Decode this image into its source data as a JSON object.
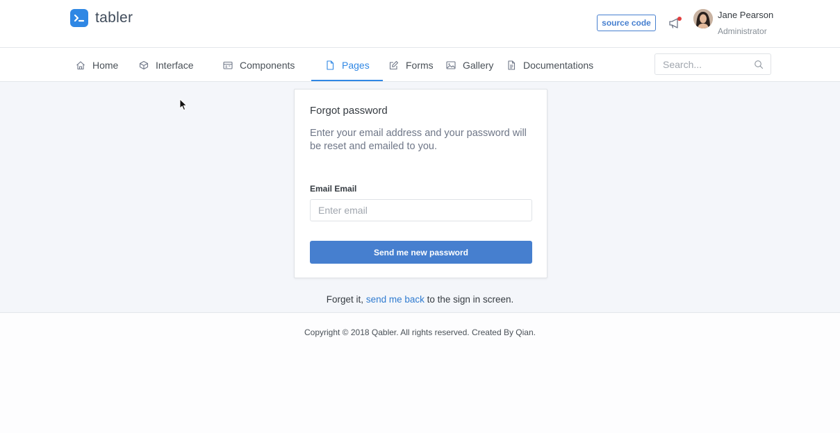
{
  "brand": {
    "name": "tabler",
    "accent_color": "#2f87e4"
  },
  "header": {
    "source_button_label": "source code",
    "user": {
      "name": "Jane Pearson",
      "role": "Administrator"
    },
    "notification_icon": "megaphone-icon"
  },
  "nav": {
    "items": [
      {
        "label": "Home",
        "icon": "home-icon"
      },
      {
        "label": "Interface",
        "icon": "box-icon"
      },
      {
        "label": "Components",
        "icon": "calendar-icon"
      },
      {
        "label": "Pages",
        "icon": "file-icon",
        "active": true
      },
      {
        "label": "Forms",
        "icon": "edit-icon"
      },
      {
        "label": "Gallery",
        "icon": "image-icon"
      },
      {
        "label": "Documentations",
        "icon": "file-text-icon"
      }
    ],
    "search_placeholder": "Search..."
  },
  "card": {
    "title": "Forgot password",
    "description": "Enter your email address and your password will be reset and emailed to you.",
    "field_label": "Email Email",
    "email_placeholder": "Enter email",
    "submit_label": "Send me new password"
  },
  "back": {
    "prefix": "Forget it,",
    "link": "send me back",
    "suffix": "to the sign in screen."
  },
  "footer": {
    "text": "Copyright © 2018 Qabler. All rights reserved. Created By Qian."
  }
}
